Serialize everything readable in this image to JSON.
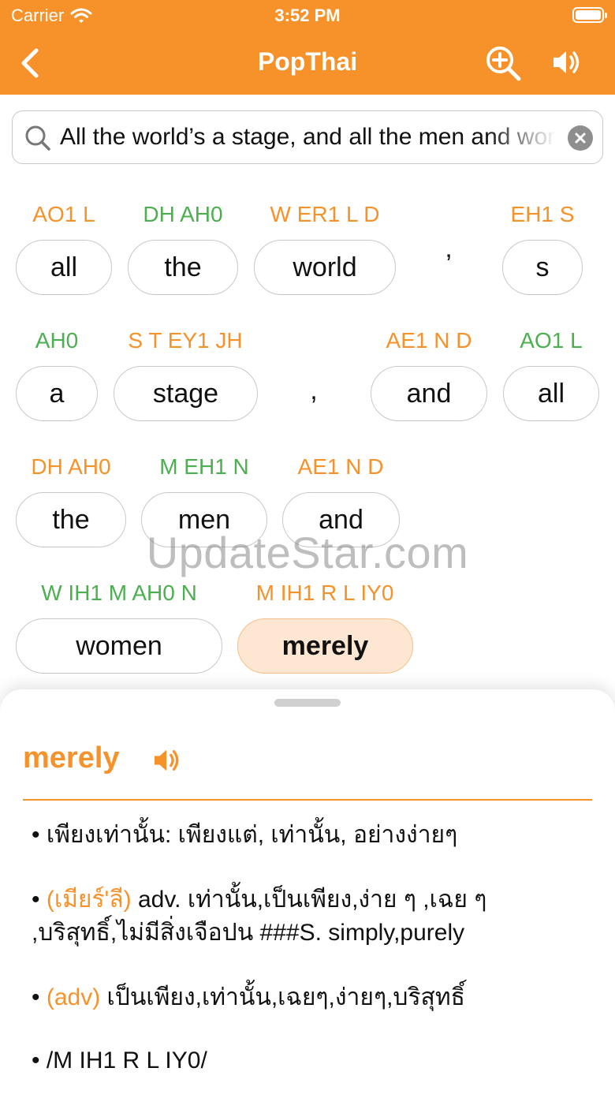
{
  "status_bar": {
    "carrier": "Carrier",
    "time": "3:52 PM"
  },
  "nav": {
    "title": "PopThai"
  },
  "search": {
    "value": "All the world’s a stage, and all the men and women merely players"
  },
  "tokens": [
    {
      "phon": "AO1 L",
      "phon_color": "orange",
      "word": "all"
    },
    {
      "phon": "DH AH0",
      "phon_color": "green",
      "word": "the"
    },
    {
      "phon": "W ER1 L D",
      "phon_color": "orange",
      "word": "world"
    },
    {
      "punct": "’"
    },
    {
      "phon": "EH1 S",
      "phon_color": "orange",
      "word": "s"
    },
    {
      "phon": "AH0",
      "phon_color": "green",
      "word": "a"
    },
    {
      "phon": "S T EY1 JH",
      "phon_color": "orange",
      "word": "stage"
    },
    {
      "punct": ","
    },
    {
      "phon": "AE1 N D",
      "phon_color": "orange",
      "word": "and"
    },
    {
      "phon": "AO1 L",
      "phon_color": "green",
      "word": "all"
    },
    {
      "phon": "DH AH0",
      "phon_color": "orange",
      "word": "the"
    },
    {
      "phon": "M EH1 N",
      "phon_color": "green",
      "word": "men"
    },
    {
      "phon": "AE1 N D",
      "phon_color": "orange",
      "word": "and"
    },
    {
      "phon": "W IH1 M AH0 N",
      "phon_color": "green",
      "word": "women"
    },
    {
      "phon": "M IH1 R L IY0",
      "phon_color": "orange",
      "word": "merely",
      "selected": true
    }
  ],
  "watermark": "UpdateStar.com",
  "definition": {
    "headword": "merely",
    "entries": [
      {
        "tag": "",
        "text": "เพียงเท่านั้น: เพียงแต่, เท่านั้น, อย่างง่ายๆ"
      },
      {
        "tag": "(เมียร์'ลี)",
        "text": "adv. เท่านั้น,เป็นเพียง,ง่าย ๆ ,เฉย ๆ ,บริสุทธิ์,ไม่มีสิ่งเจือปน  ###S. simply,purely"
      },
      {
        "tag": "(adv)",
        "text": "เป็นเพียง,เท่านั้น,เฉยๆ,ง่ายๆ,บริสุทธิ์"
      },
      {
        "tag": "",
        "text": "/M IH1 R L IY0/"
      }
    ]
  },
  "colors": {
    "accent": "#f7922a",
    "phon_green": "#4caf50",
    "selected_bg": "#fde7d3"
  }
}
